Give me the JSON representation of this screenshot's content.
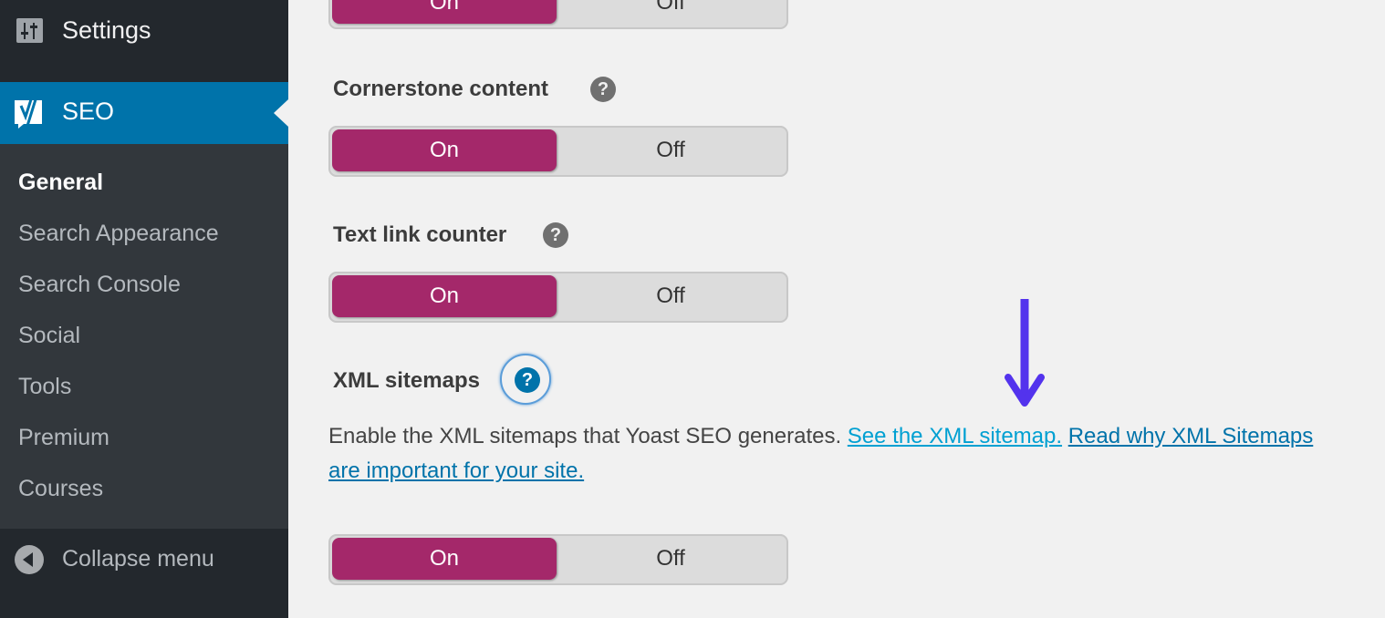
{
  "sidebar": {
    "settings_label": "Settings",
    "seo_label": "SEO",
    "submenu": [
      {
        "label": "General",
        "active": true
      },
      {
        "label": "Search Appearance",
        "active": false
      },
      {
        "label": "Search Console",
        "active": false
      },
      {
        "label": "Social",
        "active": false
      },
      {
        "label": "Tools",
        "active": false
      },
      {
        "label": "Premium",
        "active": false
      },
      {
        "label": "Courses",
        "active": false
      }
    ],
    "collapse_label": "Collapse menu"
  },
  "main": {
    "top_toggle": {
      "on_label": "On",
      "off_label": "Off",
      "value": "On"
    },
    "sections": [
      {
        "title": "Cornerstone content",
        "help": "?",
        "toggle": {
          "on_label": "On",
          "off_label": "Off",
          "value": "On"
        }
      },
      {
        "title": "Text link counter",
        "help": "?",
        "toggle": {
          "on_label": "On",
          "off_label": "Off",
          "value": "On"
        }
      },
      {
        "title": "XML sitemaps",
        "help": "?",
        "description": "Enable the XML sitemaps that Yoast SEO generates.",
        "link_see": "See the XML sitemap.",
        "link_read": "Read why XML Sitemaps are important for your site.",
        "toggle": {
          "on_label": "On",
          "off_label": "Off",
          "value": "On"
        }
      }
    ]
  },
  "colors": {
    "sidebar_bg": "#23282d",
    "submenu_bg": "#32373c",
    "active_menu": "#0073aa",
    "toggle_on": "#a4286a",
    "link_primary": "#00a0d2",
    "link_secondary": "#0073aa",
    "annotation_arrow": "#5333ed"
  }
}
